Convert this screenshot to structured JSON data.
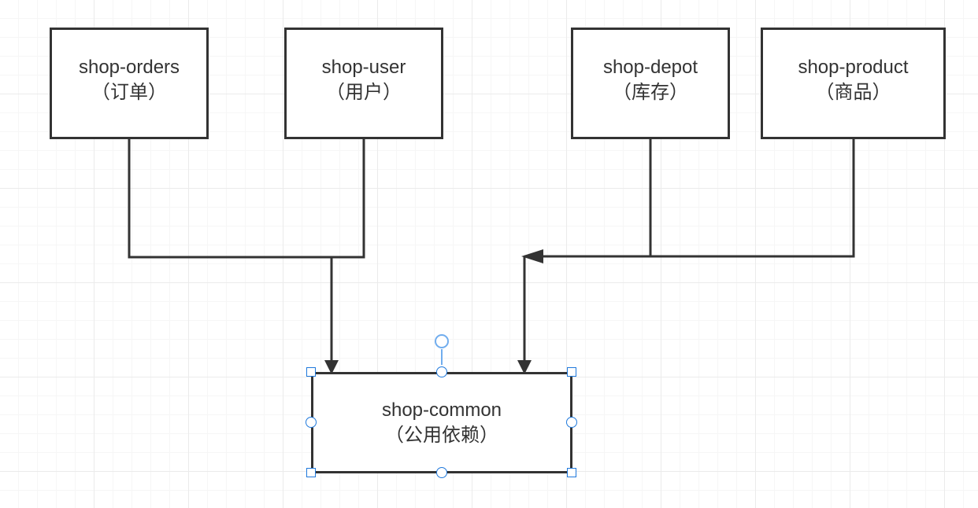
{
  "diagram": {
    "nodes": [
      {
        "id": "shop-orders",
        "name": "shop-orders",
        "desc": "（订单）"
      },
      {
        "id": "shop-user",
        "name": "shop-user",
        "desc": "（用户）"
      },
      {
        "id": "shop-depot",
        "name": "shop-depot",
        "desc": "（库存）"
      },
      {
        "id": "shop-product",
        "name": "shop-product",
        "desc": "（商品）"
      },
      {
        "id": "shop-common",
        "name": "shop-common",
        "desc": "（公用依赖）",
        "selected": true
      }
    ],
    "edges": [
      {
        "from": [
          "shop-orders",
          "shop-user"
        ],
        "to": "shop-common"
      },
      {
        "from": [
          "shop-depot",
          "shop-product"
        ],
        "to": "shop-common"
      }
    ]
  },
  "colors": {
    "node_border": "#333333",
    "connector": "#333333",
    "selection": "#1e78dc",
    "rotate_handle": "#71adee",
    "grid_major": "#ebebeb",
    "grid_minor": "#f6f6f6"
  }
}
